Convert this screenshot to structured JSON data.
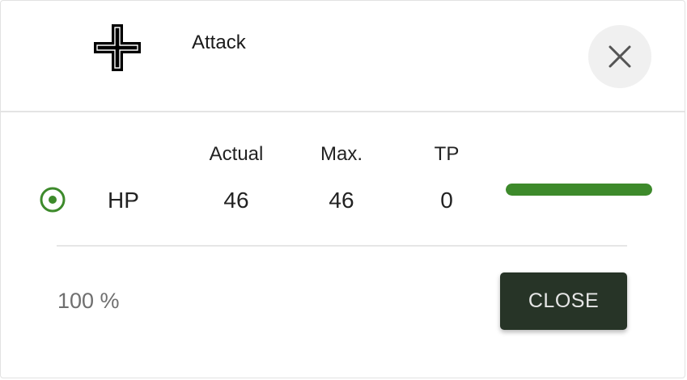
{
  "header": {
    "title": "Attack",
    "unit_icon": "iron-cross-icon",
    "close_icon": "close-icon"
  },
  "table": {
    "columns": [
      "Actual",
      "Max.",
      "TP"
    ],
    "rows": [
      {
        "label": "HP",
        "actual": "46",
        "max": "46",
        "tp": "0",
        "bar_fraction": 1.0,
        "selected": true
      }
    ]
  },
  "footer": {
    "percent": "100 %",
    "close_label": "CLOSE"
  },
  "colors": {
    "accent_green": "#3d8a2b",
    "button_bg": "#273427"
  }
}
